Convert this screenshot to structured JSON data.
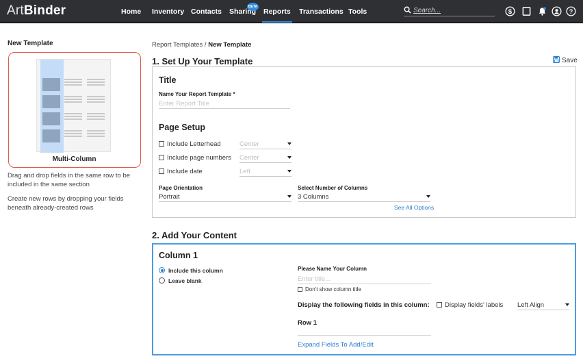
{
  "brand": {
    "logo_light": "Art",
    "logo_bold": "Binder"
  },
  "nav": {
    "items": [
      "Home",
      "Inventory",
      "Contacts",
      "Sharing",
      "Reports",
      "Transactions",
      "Tools"
    ],
    "beta_badge": "BETA",
    "active": "Reports",
    "search_placeholder": "Search..."
  },
  "icons": [
    "search-icon",
    "dollar-icon",
    "tablet-icon",
    "bell-icon",
    "user-icon",
    "help-icon",
    "save-icon"
  ],
  "colors": {
    "accent": "#2f8fe0",
    "highlight_border": "#e25b4b",
    "topbar": "#2f3033"
  },
  "left": {
    "title": "New Template",
    "layout_label": "Multi-Column",
    "help1": "Drag and drop fields in the same row to be included in the same section",
    "help2": "Create new rows by dropping your fields beneath already-created rows"
  },
  "breadcrumb": {
    "parent": "Report Templates",
    "sep": "/",
    "current": "New Template"
  },
  "setup": {
    "heading": "1. Set Up Your Template",
    "save_label": "Save",
    "title_section": "Title",
    "name_label": "Name Your Report Template *",
    "name_placeholder": "Enter Report Title",
    "page_setup": "Page Setup",
    "options": [
      {
        "label": "Include Letterhead",
        "value": "Center"
      },
      {
        "label": "Include page numbers",
        "value": "Center"
      },
      {
        "label": "Include date",
        "value": "Left"
      }
    ],
    "orientation_label": "Page Orientation",
    "orientation_value": "Portrait",
    "columns_label": "Select Number of Columns",
    "columns_value": "3 Columns",
    "see_all": "See All Options"
  },
  "content": {
    "heading": "2. Add Your Content",
    "column_title": "Column 1",
    "radio_include": "Include this column",
    "radio_blank": "Leave blank",
    "name_col_label": "Please Name Your Column",
    "name_col_placeholder": "Enter title...",
    "dont_show": "Don't show column title",
    "display_fields": "Display the following fields in this column:",
    "display_labels": "Display fields' labels",
    "align_value": "Left Align",
    "row_label": "Row 1",
    "expand_link": "Expand Fields To Add/Edit"
  }
}
